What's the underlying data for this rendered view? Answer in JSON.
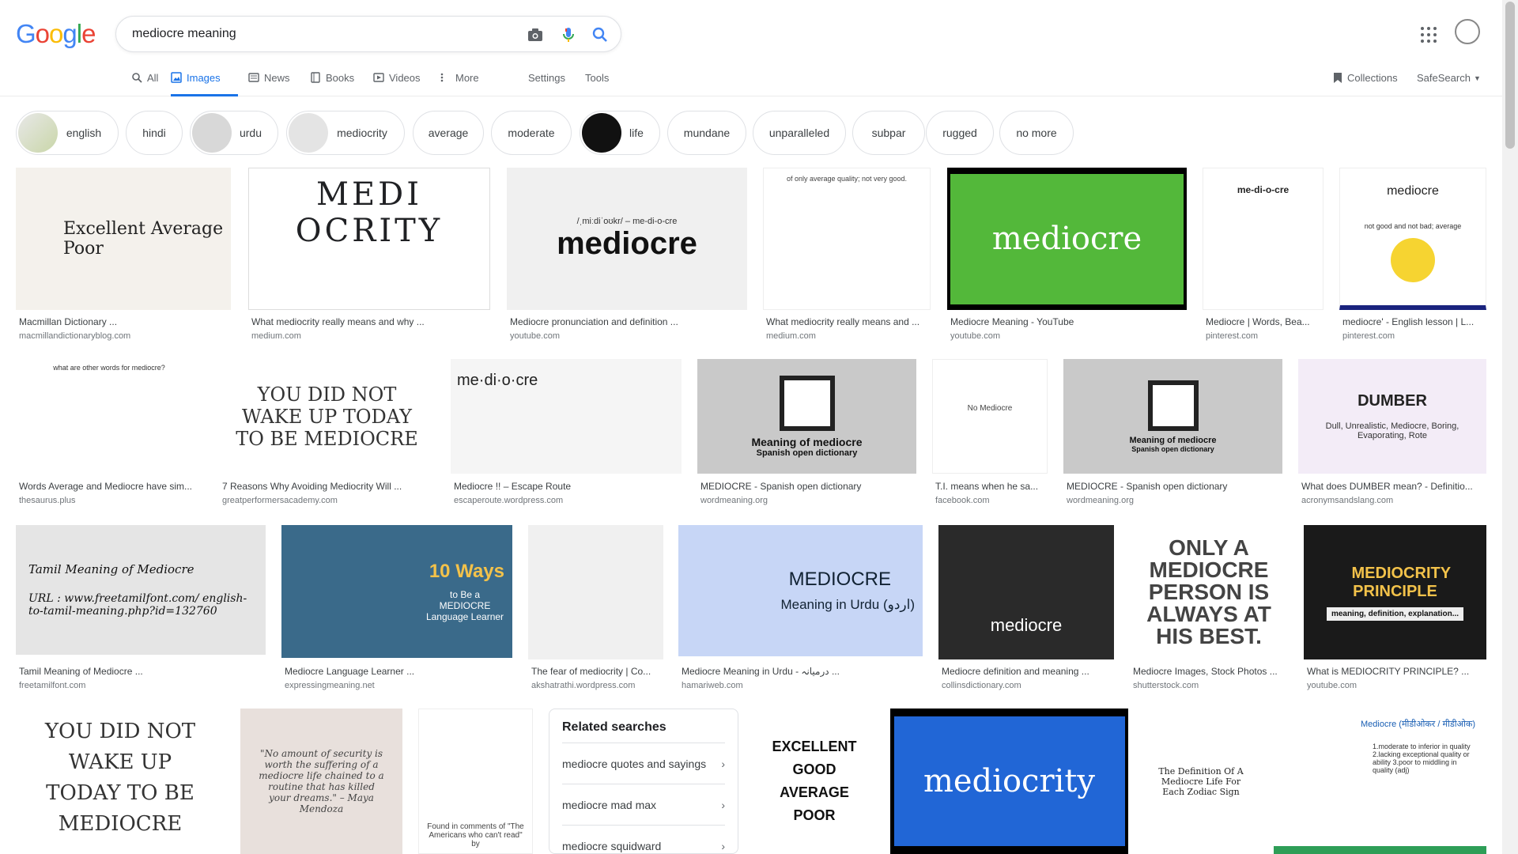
{
  "logo": {
    "letters": [
      "G",
      "o",
      "o",
      "g",
      "l",
      "e"
    ],
    "colors": [
      "#4285f4",
      "#ea4335",
      "#fbbc05",
      "#4285f4",
      "#34a853",
      "#ea4335"
    ]
  },
  "search": {
    "query": "mediocre meaning"
  },
  "tabs": [
    "All",
    "Images",
    "News",
    "Books",
    "Videos",
    "More"
  ],
  "tools": {
    "settings": "Settings",
    "tools": "Tools",
    "collections": "Collections",
    "safesearch": "SafeSearch"
  },
  "chips": [
    "english",
    "hindi",
    "urdu",
    "mediocrity",
    "average",
    "moderate",
    "life",
    "mundane",
    "unparalleled",
    "subpar",
    "rugged",
    "no more"
  ],
  "results": [
    {
      "title": "Macmillan Dictionary ...",
      "domain": "macmillandictionaryblog.com",
      "image_text": "Excellent  Average  Poor"
    },
    {
      "title": "What mediocrity really means and why ...",
      "domain": "medium.com",
      "image_text": "MEDI OCRITY"
    },
    {
      "title": "Mediocre pronunciation and definition ...",
      "domain": "youtube.com",
      "image_text": "mediocre",
      "image_sub": "/ˌmiːdiˈoʊkr/ – me-di-o-cre"
    },
    {
      "title": "What mediocrity really means and ...",
      "domain": "medium.com",
      "image_text": "of only average quality; not very good."
    },
    {
      "title": "Mediocre Meaning - YouTube",
      "domain": "youtube.com",
      "image_text": "mediocre"
    },
    {
      "title": "Mediocre | Words, Bea...",
      "domain": "pinterest.com",
      "image_text": "me-di-o-cre"
    },
    {
      "title": "mediocre' - English lesson | L...",
      "domain": "pinterest.com",
      "image_text": "mediocre",
      "image_sub": "not good and not bad; average"
    },
    {
      "title": "Words Average and Mediocre have sim...",
      "domain": "thesaurus.plus",
      "image_text": "what are other words for mediocre?"
    },
    {
      "title": "7 Reasons Why Avoiding Mediocrity Will ...",
      "domain": "greatperformersacademy.com",
      "image_text": "YOU DID NOT WAKE UP TODAY TO BE MEDIOCRE"
    },
    {
      "title": "Mediocre !! – Escape Route",
      "domain": "escaperoute.wordpress.com",
      "image_text": "me·di·o·cre"
    },
    {
      "title": "MEDIOCRE - Spanish open dictionary",
      "domain": "wordmeaning.org",
      "image_text": "Meaning of mediocre",
      "image_sub": "Spanish open dictionary"
    },
    {
      "title": "T.I. means when he sa...",
      "domain": "facebook.com",
      "image_text": "No Mediocre"
    },
    {
      "title": "MEDIOCRE - Spanish open dictionary",
      "domain": "wordmeaning.org",
      "image_text": "Meaning of mediocre",
      "image_sub": "Spanish open dictionary"
    },
    {
      "title": "What does DUMBER mean? - Definitio...",
      "domain": "acronymsandslang.com",
      "image_text": "DUMBER",
      "image_sub": "Dull, Unrealistic, Mediocre, Boring, Evaporating, Rote"
    },
    {
      "title": "Tamil Meaning of Mediocre ...",
      "domain": "freetamilfont.com",
      "image_text": "Tamil Meaning of Mediocre",
      "image_sub": "URL : www.freetamilfont.com/ english-to-tamil-meaning.php?id=132760"
    },
    {
      "title": "Mediocre Language Learner ...",
      "domain": "expressingmeaning.net",
      "image_text": "10 Ways",
      "image_sub": "to Be a MEDIOCRE Language Learner"
    },
    {
      "title": "The fear of mediocrity | Co...",
      "domain": "akshatrathi.wordpress.com",
      "image_text": ""
    },
    {
      "title": "Mediocre Meaning in Urdu - درمیانہ ...",
      "domain": "hamariweb.com",
      "image_text": "MEDIOCRE",
      "image_sub": "Meaning in Urdu (اردو)"
    },
    {
      "title": "Mediocre definition and meaning ...",
      "domain": "collinsdictionary.com",
      "image_text": "mediocre"
    },
    {
      "title": "Mediocre Images, Stock Photos ...",
      "domain": "shutterstock.com",
      "image_text": "ONLY A MEDIOCRE PERSON IS ALWAYS AT HIS BEST."
    },
    {
      "title": "What is MEDIOCRITY PRINCIPLE? ...",
      "domain": "youtube.com",
      "image_text": "MEDIOCRITY PRINCIPLE",
      "image_sub": "meaning, definition, explanation..."
    },
    {
      "title": "",
      "domain": "",
      "image_text": "YOU DID NOT WAKE UP TODAY TO BE MEDIOCRE"
    },
    {
      "title": "",
      "domain": "",
      "image_text": "\"No amount of security is worth the suffering of a mediocre life chained to a routine that has killed your dreams.\" – Maya Mendoza"
    },
    {
      "title": "",
      "domain": "",
      "image_text": "Found in comments of \"The Americans who can't read\" by"
    },
    {
      "title": "",
      "domain": "",
      "image_text": "EXCELLENT GOOD AVERAGE POOR"
    },
    {
      "title": "",
      "domain": "",
      "image_text": "mediocrity"
    },
    {
      "title": "",
      "domain": "",
      "image_text": "The Definition Of A Mediocre Life For Each Zodiac Sign"
    },
    {
      "title": "",
      "domain": "",
      "image_text": "Mediocre (मीडीओकर / मीडीओक)",
      "image_sub": "1.moderate to inferior in quality 2.lacking exceptional quality or ability 3.poor to middling in quality (adj)"
    }
  ],
  "related": {
    "heading": "Related searches",
    "items": [
      "mediocre quotes and sayings",
      "mediocre mad max",
      "mediocre squidward"
    ]
  }
}
